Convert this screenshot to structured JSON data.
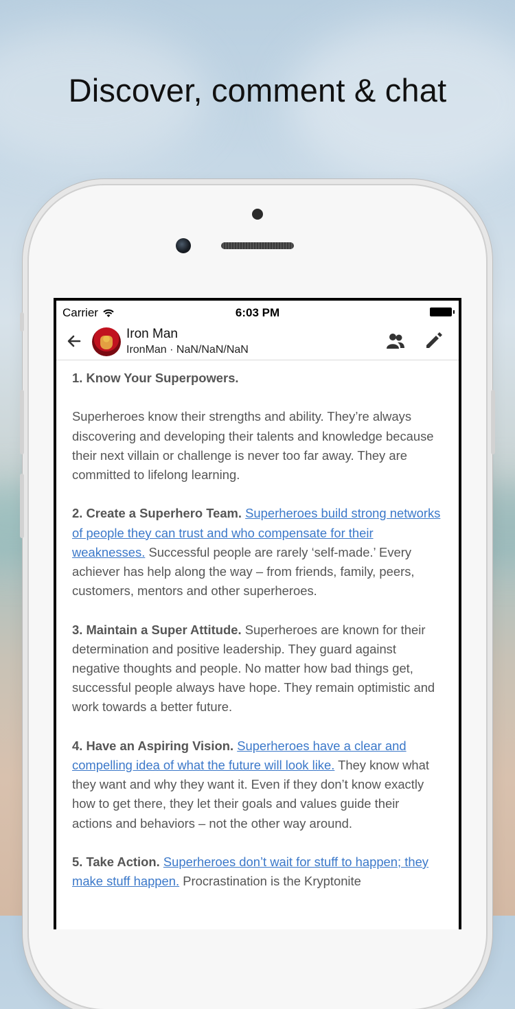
{
  "headline": "Discover, comment & chat",
  "status": {
    "carrier": "Carrier",
    "time": "6:03 PM"
  },
  "header": {
    "name": "Iron Man",
    "subtitle": "IronMan · NaN/NaN/NaN"
  },
  "icons": {
    "back": "back-arrow-icon",
    "people": "people-icon",
    "edit": "pencil-icon",
    "wifi": "wifi-icon",
    "battery": "battery-icon"
  },
  "colors": {
    "link": "#3b78c9",
    "text": "#555555"
  },
  "article": {
    "p1": {
      "title": "1. Know Your Superpowers."
    },
    "p2": {
      "text": "Superheroes know their strengths and ability. They’re always discovering and developing their talents and knowledge because their next villain or challenge is never too far away. They are committed to lifelong learning."
    },
    "p3": {
      "title": "2. Create a Superhero Team.",
      "link": "Superheroes build strong networks of people they can trust and who compensate for their weaknesses.",
      "text": "Successful people are rarely ‘self-made.’ Every achiever has help along the way – from friends, family, peers, customers, mentors and other superheroes."
    },
    "p4": {
      "title": "3. Maintain a Super Attitude.",
      "text": "Superheroes are known for their determination and positive leadership. They guard against negative thoughts and people. No matter how bad things get, successful people always have hope. They remain optimistic and work towards a better future."
    },
    "p5": {
      "title": "4. Have an Aspiring Vision.",
      "link": "Superheroes have a clear and compelling idea of what the future will look like.",
      "text": "They know what they want and why they want it. Even if they don’t know exactly how to get there, they let their goals and values guide their actions and behaviors – not the other way around."
    },
    "p6": {
      "title": "5. Take Action.",
      "link": "Superheroes don’t wait for stuff to happen; they make stuff happen.",
      "text": "Procrastination is the Kryptonite"
    }
  }
}
